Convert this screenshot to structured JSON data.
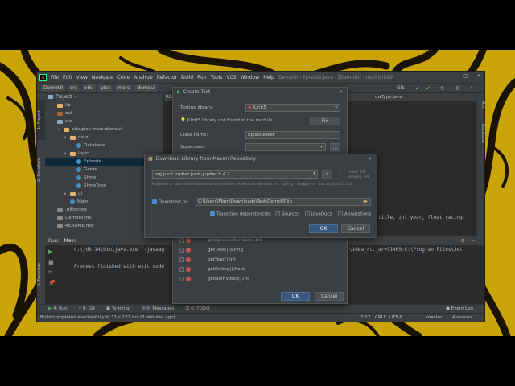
{
  "ide": {
    "title": "DemoUI - Episode.java - [DemoUI] - IntelliJ IDEA",
    "menu": [
      "File",
      "Edit",
      "View",
      "Navigate",
      "Code",
      "Analyze",
      "Refactor",
      "Build",
      "Run",
      "Tools",
      "VCS",
      "Window",
      "Help"
    ],
    "breadcrumbs": [
      "DemoUI",
      "src",
      "edu",
      "picc",
      "marc",
      "demoui"
    ],
    "git_label": "Git:",
    "project_label": "Project",
    "tree": [
      {
        "label": "lib",
        "depth": 1,
        "kind": "folder"
      },
      {
        "label": "out",
        "depth": 1,
        "kind": "folder-red"
      },
      {
        "label": "src",
        "depth": 1,
        "kind": "folder-blue"
      },
      {
        "label": "edu.picc.marc.demoui",
        "depth": 2,
        "kind": "folder"
      },
      {
        "label": "data",
        "depth": 3,
        "kind": "folder"
      },
      {
        "label": "Database",
        "depth": 4,
        "kind": "class"
      },
      {
        "label": "logic",
        "depth": 3,
        "kind": "folder"
      },
      {
        "label": "Episode",
        "depth": 4,
        "kind": "class",
        "selected": true
      },
      {
        "label": "Genre",
        "depth": 4,
        "kind": "class"
      },
      {
        "label": "Show",
        "depth": 4,
        "kind": "class"
      },
      {
        "label": "ShowType",
        "depth": 4,
        "kind": "class"
      },
      {
        "label": "ui",
        "depth": 3,
        "kind": "folder"
      },
      {
        "label": "Main",
        "depth": 3,
        "kind": "class"
      },
      {
        "label": ".gitignore",
        "depth": 1,
        "kind": "file"
      },
      {
        "label": "DemoUI.iml",
        "depth": 1,
        "kind": "file"
      },
      {
        "label": "README.md",
        "depth": 1,
        "kind": "file"
      }
    ],
    "editor_tab": "REA",
    "editor_tab_right": "owType.java",
    "code_line": "title, int year, float rating,",
    "run_label": "Run:",
    "run_tab": "Main",
    "console": [
      "C:\\jdk-14\\bin\\java.exe \"-javaag",
      "",
      "Process finished with exit code"
    ],
    "console_right": "\\idea_rt.jar=51469:C:\\Program Files\\Jet",
    "bottom_tabs": [
      "4: Run",
      "9: Git",
      "Terminal",
      "0: Messages",
      "6: TODO"
    ],
    "event_log": "Event Log",
    "status_text": "Build completed successfully in 11 s 172 ms (3 minutes ago)",
    "status_right": [
      "7:17",
      "CRLF",
      "UTF-8",
      "master",
      "4 spaces"
    ],
    "left_tabs": [
      "1: Project",
      "2: Structure",
      "2: Favorites"
    ],
    "right_tabs": [
      "Ant",
      "Database"
    ]
  },
  "create_test": {
    "title": "Create Test",
    "testing_library_label": "Testing library:",
    "testing_library_value": "JUnit5",
    "warning": "JUnit5 library not found in the module",
    "fix_button": "Fix",
    "class_name_label": "Class name:",
    "class_name_value": "EpisodeTest",
    "superclass_label": "Superclass:",
    "superclass_value": "",
    "more_button": "...",
    "methods": [
      "getEpisodeNumber():int",
      "getTitle():String",
      "getYear():int",
      "getRating():float",
      "getNumVotes():int"
    ],
    "ok_button": "OK",
    "cancel_button": "Cancel"
  },
  "download": {
    "title": "Download Library from Maven Repository",
    "search_value": "org.junit.jupiter:junit-jupiter:5.4.2",
    "found_text": "Found: 196",
    "showing_text": "Showing: 196",
    "hint": "Keyword or class name to search by or exact Maven coordinates, i.e. 'spring', 'Logger' or 'ant:ant-junit:1.6.5'",
    "download_to_label": "Download to:",
    "download_to_value": "C:\\Users\\Marc\\Downloads\\Test\\DemoUI\\lib",
    "transitive_label": "Transitive dependencies",
    "sources_label": "Sources",
    "javadocs_label": "JavaDocs",
    "annotations_label": "Annotations",
    "ok_button": "OK",
    "cancel_button": "Cancel"
  },
  "colors": {
    "accent": "#365880",
    "selection": "#0d293e",
    "background": "#c9a406"
  }
}
